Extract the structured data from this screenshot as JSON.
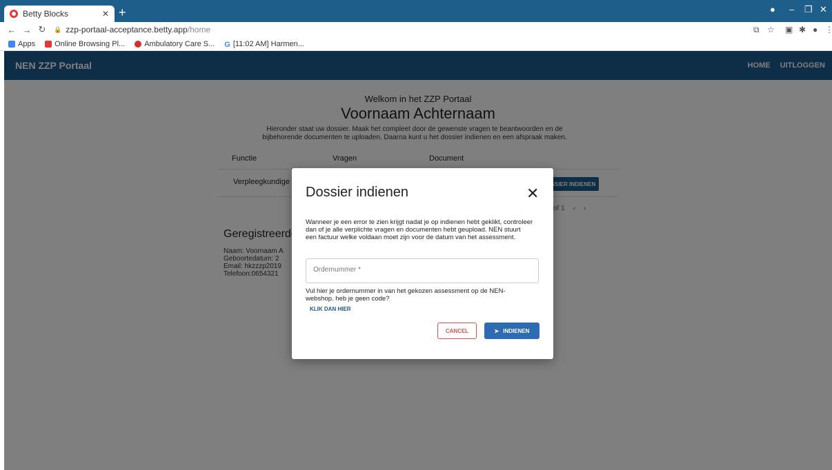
{
  "browser": {
    "tab_title": "Betty Blocks",
    "url_domain": "zzp-portaal-acceptance.betty.app",
    "url_path": "/home",
    "bookmarks": [
      "Apps",
      "Online Browsing Pl...",
      "Ambulatory Care S...",
      "[11:02 AM] Harmen..."
    ]
  },
  "app": {
    "title": "NEN ZZP Portaal",
    "nav": [
      "HOME",
      "UITLOGGEN"
    ]
  },
  "page": {
    "welcome": "Welkom in het ZZP Portaal",
    "name": "Voornaam Achternaam",
    "intro": "Hieronder staat uw dossier. Maak het compleet door de gewenste vragen te beantwoorden en de bijbehorende documenten te uploaden. Daarna kunt u het dossier indienen en een afspraak maken.",
    "table": {
      "headers": [
        "Functie",
        "Vragen",
        "Document"
      ],
      "row_function": "Verpleegkundige n",
      "action_label": "SSIER INDIENEN",
      "pager_text": "of 1"
    },
    "registered": {
      "title": "Geregistreerde",
      "lines": [
        "Naam: Voornaam A",
        "Geboortedatum: 2",
        "Email: hkzzzp2019",
        "Telefoon:0654321"
      ]
    }
  },
  "modal": {
    "title": "Dossier indienen",
    "body": "Wanneer je een error te zien krijgt nadat je op indienen hebt geklikt, controleer dan of je alle verplichte vragen en documenten hebt geupload. NEN stuurt een factuur welke voldaan moet zijn voor de datum van het assessment.",
    "order_placeholder": "Ordernummer *",
    "help": "Vul hier je ordernummer in van het gekozen assessment op de NEN-webshop. heb je geen code?",
    "link": "KLIK DAN HIER",
    "cancel": "CANCEL",
    "submit": "INDIENEN"
  },
  "colors": {
    "primary": "#1c5a8c",
    "tabstrip": "#1d5f8a",
    "danger": "#d9534f"
  }
}
